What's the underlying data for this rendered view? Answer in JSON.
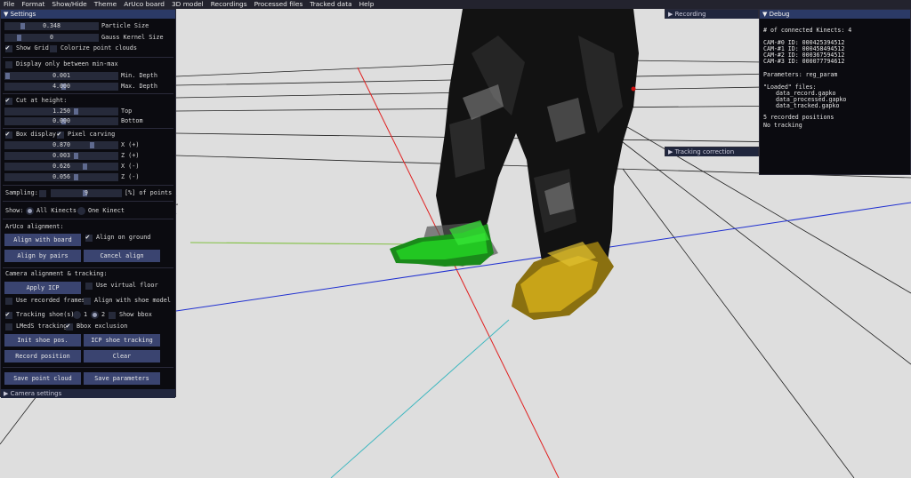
{
  "menu": [
    "File",
    "Format",
    "Show/Hide",
    "Theme",
    "ArUco board",
    "3D model",
    "Recordings",
    "Processed files",
    "Tracked data",
    "Help"
  ],
  "settings": {
    "title": "▼ Settings",
    "particle_size": {
      "value": "0.348",
      "label": "Particle Size"
    },
    "gauss_kernel": {
      "value": "0",
      "label": "Gauss Kernel Size"
    },
    "show_grid": "Show Grid",
    "colorize": "Colorize point clouds",
    "display_only": "Display only between min-max",
    "min_depth": {
      "value": "0.001",
      "label": "Min. Depth"
    },
    "max_depth": {
      "value": "4.000",
      "label": "Max. Depth"
    },
    "cut_at_height": "Cut at height:",
    "top": {
      "value": "1.250",
      "label": "Top"
    },
    "bottom": {
      "value": "0.000",
      "label": "Bottom"
    },
    "box_display": "Box display",
    "pixel_carving": "Pixel carving",
    "x_plus": {
      "value": "0.870",
      "label": "X (+)"
    },
    "z_plus": {
      "value": "0.003",
      "label": "Z (+)"
    },
    "x_minus": {
      "value": "0.626",
      "label": "X (-)"
    },
    "z_minus": {
      "value": "0.056",
      "label": "Z (-)"
    },
    "sampling_label": "Sampling:",
    "sampling_value": "9",
    "sampling_suffix": "[%] of points",
    "show_label": "Show:",
    "all_kinects": "All Kinects",
    "one_kinect": "One Kinect",
    "aruco_title": "ArUco alignment:",
    "align_with_board": "Align with board",
    "align_on_ground": "Align on ground",
    "align_by_pairs": "Align by pairs",
    "cancel_align": "Cancel align",
    "camera_title": "Camera alignment & tracking:",
    "apply_icp": "Apply ICP",
    "use_virtual_floor": "Use virtual floor",
    "use_recorded_frames": "Use recorded frames",
    "align_with_shoe_model": "Align with shoe model",
    "tracking_shoes": "Tracking shoe(s)",
    "radio_1": "1",
    "radio_2": "2",
    "show_bbox": "Show bbox",
    "lmeds_tracking": "LMedS tracking",
    "bbox_exclusion": "Bbox exclusion",
    "init_shoe_pos": "Init shoe pos.",
    "icp_shoe_tracking": "ICP shoe tracking",
    "record_position": "Record position",
    "clear": "Clear",
    "save_point_cloud": "Save point cloud",
    "save_parameters": "Save parameters",
    "camera_settings": "▶ Camera settings"
  },
  "recording_title": "▶ Recording",
  "tracking_correction_title": "▶ Tracking correction",
  "debug": {
    "title": "▼ Debug",
    "connected": "# of connected Kinects: 4",
    "cams": [
      "CAM-#0 ID: 000425394512",
      "CAM-#1 ID: 000458494512",
      "CAM-#2 ID: 000367594512",
      "CAM-#3 ID: 000077794612"
    ],
    "parameters": "Parameters: reg_param",
    "loaded_title": "\"Loaded\" files:",
    "files": [
      "data_record.gapko",
      "data_processed.gapko",
      "data_tracked.gapko"
    ],
    "positions": "5 recorded positions",
    "tracking": "No tracking"
  },
  "colors": {
    "panel_bg": "#0b0b10",
    "title_bg": "#2b3a66",
    "button_bg": "#3a4470",
    "scene_bg": "#dedede",
    "axis_red": "#e02020",
    "axis_blue": "#2030d0",
    "axis_cyan": "#40b8c0",
    "axis_green": "#80c040",
    "shoe_left": "#22c722",
    "shoe_right": "#c8a418"
  }
}
